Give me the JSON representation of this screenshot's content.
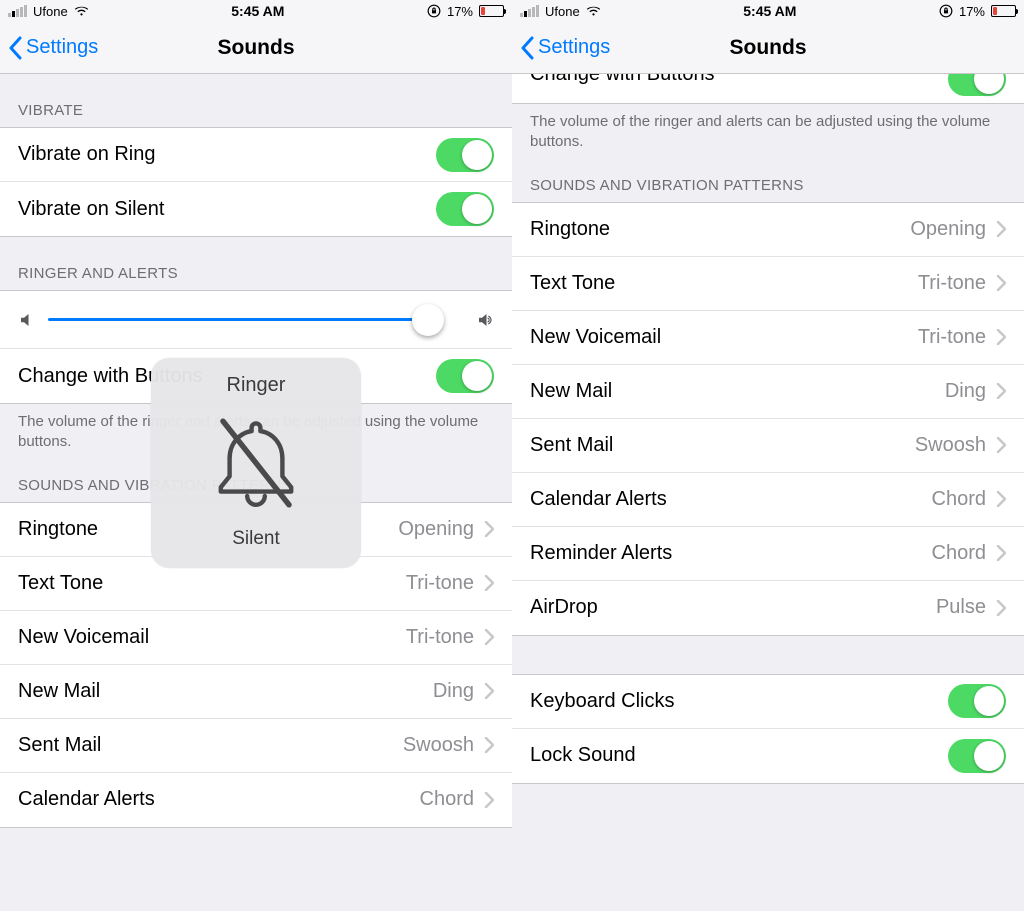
{
  "status": {
    "carrier": "Ufone",
    "time": "5:45 AM",
    "battery_pct": "17%"
  },
  "nav": {
    "back_label": "Settings",
    "title": "Sounds"
  },
  "left": {
    "vibrate_header": "VIBRATE",
    "vibrate_on_ring": "Vibrate on Ring",
    "vibrate_on_silent": "Vibrate on Silent",
    "ringer_header": "RINGER AND ALERTS",
    "change_with_buttons": "Change with Buttons",
    "volume_note": "The volume of the ringer and alerts can be adjusted using the volume buttons.",
    "patterns_header": "SOUNDS AND VIBRATION PATTERNS",
    "items": [
      {
        "label": "Ringtone",
        "value": "Opening"
      },
      {
        "label": "Text Tone",
        "value": "Tri-tone"
      },
      {
        "label": "New Voicemail",
        "value": "Tri-tone"
      },
      {
        "label": "New Mail",
        "value": "Ding"
      },
      {
        "label": "Sent Mail",
        "value": "Swoosh"
      },
      {
        "label": "Calendar Alerts",
        "value": "Chord"
      }
    ],
    "hud_title": "Ringer",
    "hud_sub": "Silent"
  },
  "right": {
    "cut_row_label": "Change with Buttons",
    "volume_note": "The volume of the ringer and alerts can be adjusted using the volume buttons.",
    "patterns_header": "SOUNDS AND VIBRATION PATTERNS",
    "items": [
      {
        "label": "Ringtone",
        "value": "Opening"
      },
      {
        "label": "Text Tone",
        "value": "Tri-tone"
      },
      {
        "label": "New Voicemail",
        "value": "Tri-tone"
      },
      {
        "label": "New Mail",
        "value": "Ding"
      },
      {
        "label": "Sent Mail",
        "value": "Swoosh"
      },
      {
        "label": "Calendar Alerts",
        "value": "Chord"
      },
      {
        "label": "Reminder Alerts",
        "value": "Chord"
      },
      {
        "label": "AirDrop",
        "value": "Pulse"
      }
    ],
    "keyboard_clicks": "Keyboard Clicks",
    "lock_sound": "Lock Sound"
  }
}
